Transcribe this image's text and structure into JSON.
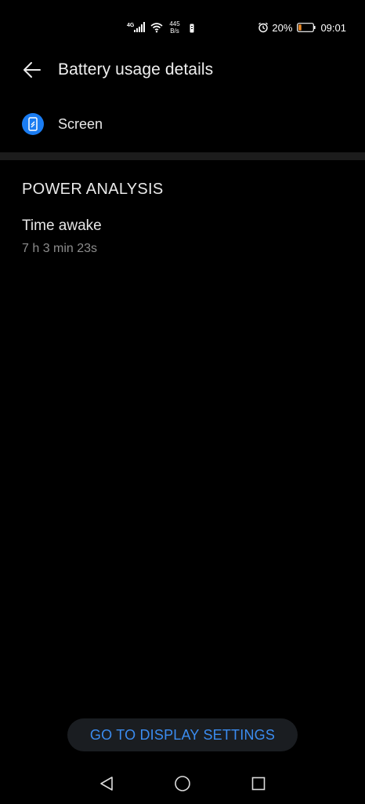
{
  "status_bar": {
    "network_type": "4G",
    "net_speed_value": "445",
    "net_speed_unit": "B/s",
    "battery_percent": "20%",
    "time": "09:01",
    "battery_level": 0.2,
    "battery_color": "#f08a24"
  },
  "header": {
    "title": "Battery usage details"
  },
  "app": {
    "name": "Screen",
    "icon": "phone-screen-icon",
    "icon_color": "#1a7cf2"
  },
  "power_analysis": {
    "title": "POWER ANALYSIS",
    "time_awake_label": "Time awake",
    "time_awake_value": "7 h 3 min 23s"
  },
  "actions": {
    "go_to_display_settings": "GO TO DISPLAY SETTINGS"
  },
  "nav_bar": {
    "back_icon": "triangle-back-icon",
    "home_icon": "circle-home-icon",
    "recents_icon": "square-recents-icon"
  }
}
